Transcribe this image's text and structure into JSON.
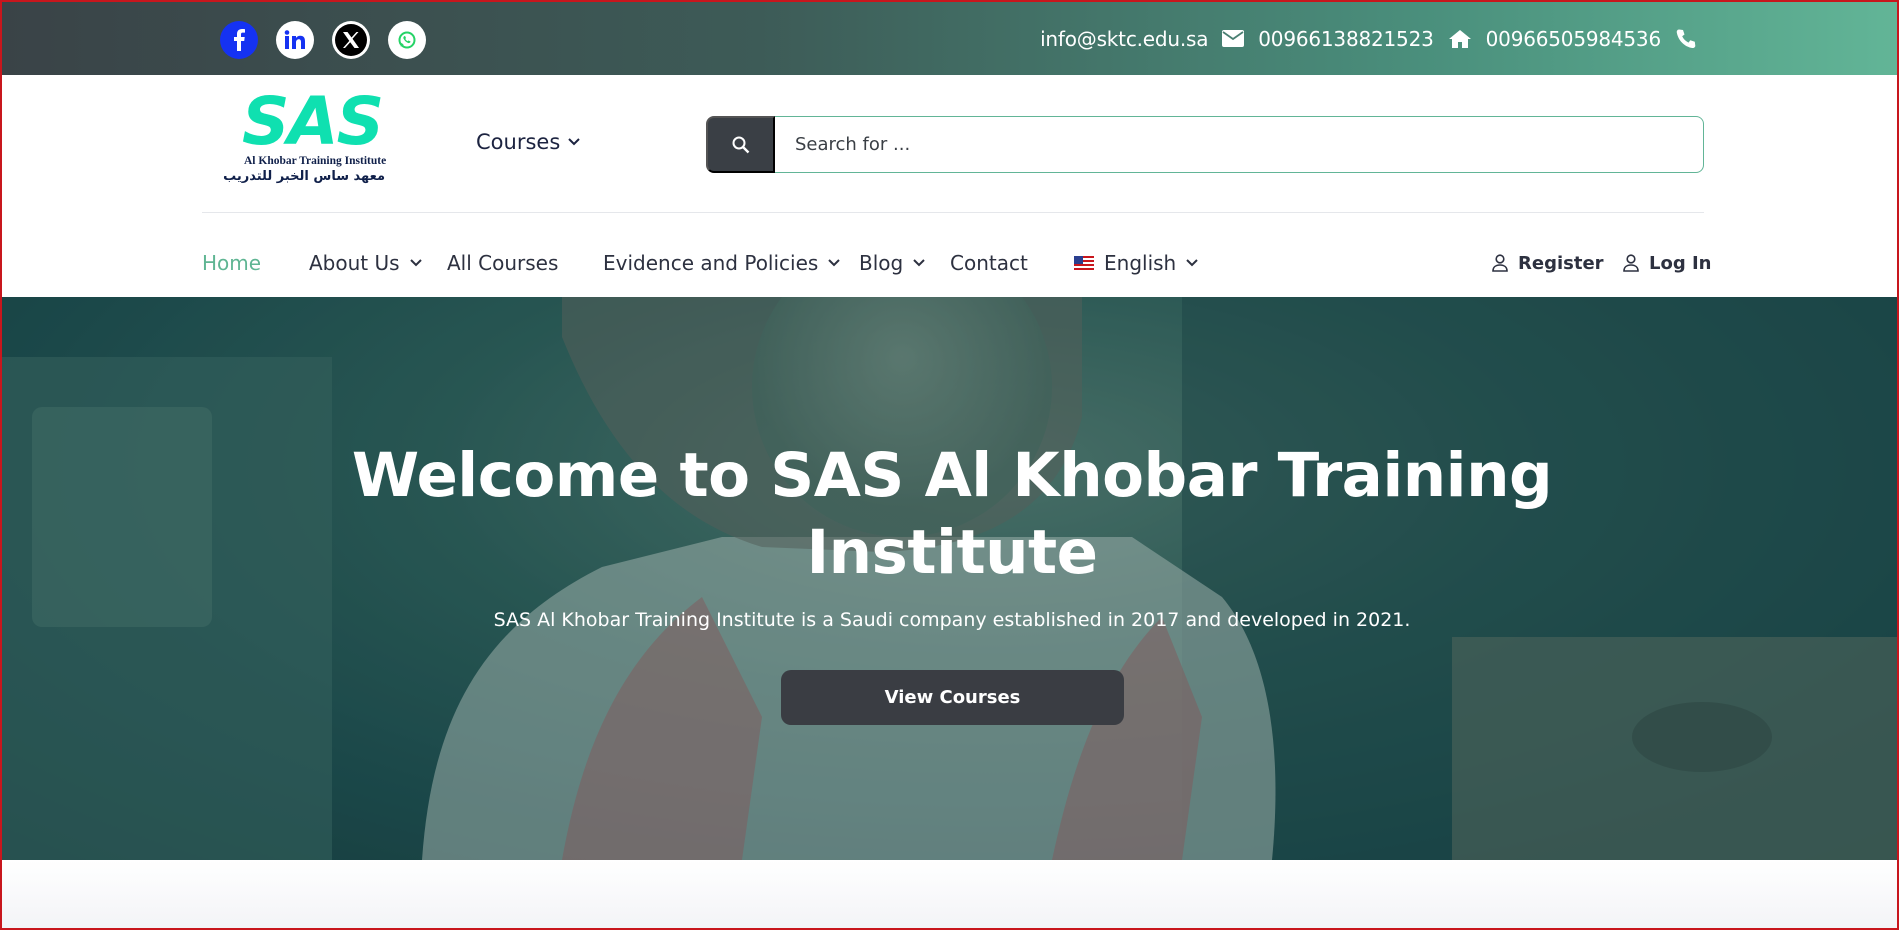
{
  "topbar": {
    "social": [
      {
        "name": "facebook-icon",
        "label": "f"
      },
      {
        "name": "linkedin-icon",
        "label": "in"
      },
      {
        "name": "x-icon",
        "label": "X"
      },
      {
        "name": "whatsapp-icon",
        "label": "whatsapp"
      }
    ],
    "email": "info@sktc.edu.sa",
    "phone1": "00966138821523",
    "phone2": "00966505984536"
  },
  "header": {
    "logo": {
      "big": "SAS",
      "en": "Al Khobar Training Institute",
      "ar": "معهد ساس الخبر للتدريب"
    },
    "courses_label": "Courses",
    "search": {
      "placeholder": "Search for ..."
    }
  },
  "nav": {
    "items": [
      {
        "label": "Home",
        "active": true
      },
      {
        "label": "About Us",
        "dropdown": true
      },
      {
        "label": "All Courses"
      },
      {
        "label": "Evidence and Policies",
        "dropdown": true
      },
      {
        "label": "Blog",
        "dropdown": true
      },
      {
        "label": "Contact"
      },
      {
        "label": "English",
        "dropdown": true
      }
    ],
    "register": "Register",
    "login": "Log In"
  },
  "hero": {
    "title": "Welcome to SAS Al Khobar Training Institute",
    "subtitle": "SAS Al Khobar Training Institute is a Saudi company established in 2017 and developed in 2021.",
    "button": "View Courses"
  },
  "colors": {
    "accent": "#5fb593",
    "facebook": "#1532f2",
    "dark_button": "#3a3d43",
    "logo_green": "#0fe0b0"
  }
}
